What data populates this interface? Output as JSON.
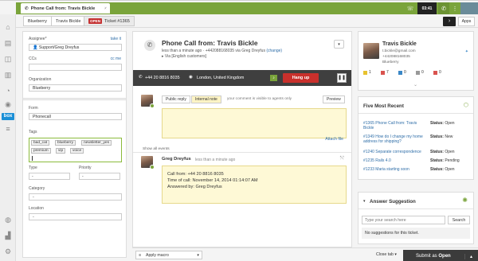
{
  "topbar": {
    "tab_title": "Phone Call from: Travis Bickle",
    "add_label": "+ add",
    "timer": "03:41"
  },
  "crumbs": {
    "org": "Blueberry",
    "user": "Travis Bickle",
    "status_badge": "OPEN",
    "ticket": "Ticket #1365",
    "apps": "Apps"
  },
  "properties": {
    "assignee_label": "Assignee*",
    "take_it": "take it",
    "assignee_value": "Support/Greg Dreyfus",
    "ccs_label": "CCs",
    "cc_me": "cc me",
    "organization_label": "Organization",
    "organization_value": "Blueberry",
    "form_label": "Form",
    "form_value": "Phonecall",
    "tags_label": "Tags",
    "tags": [
      "bad_cat",
      "blueberry",
      "newsletter_yes",
      "premium",
      "vip",
      "voice"
    ],
    "type_label": "Type",
    "type_value": "-",
    "priority_label": "Priority",
    "priority_value": "-",
    "category_label": "Category",
    "category_value": "-",
    "location_label": "Location",
    "location_value": "-"
  },
  "conversation": {
    "subject": "Phone Call from: Travis Bickle",
    "meta_line1": "less than a minute ago · +442088168035 via Greg Dreyfus",
    "change_link": "(change)",
    "meta_line2": "Via [English customers]",
    "call_number": "+44 20 8816 8035",
    "call_location": "London, United Kingdom",
    "hangup_label": "Hang up",
    "public_reply": "Public reply",
    "internal_note": "Internal note",
    "note_hint": "your comment is visible to agents only",
    "preview": "Preview",
    "attach_file": "Attach file",
    "show_all_events": "Show all events",
    "author": "Greg Dreyfus",
    "time_ago": "less than a minute ago",
    "message_lines": [
      "Call from: +44 20 8816 8035",
      "Time of call: November 14, 2014 01:14:07 AM",
      "Answered by: Greg Dreyfus"
    ]
  },
  "bottom": {
    "apply_macro": "Apply macro",
    "close_tab": "Close tab",
    "submit_prefix": "Submit as ",
    "submit_status": "Open"
  },
  "user_card": {
    "name": "Travis Bickle",
    "email": "t.bickle@gmail.com",
    "phone": "+442088168035",
    "org": "Blueberry",
    "stats": [
      "1",
      "7",
      "0",
      "0",
      "0"
    ],
    "stat_colors": [
      "#e8c22e",
      "#d9534f",
      "#3a87c6",
      "#999999",
      "#d9534f"
    ]
  },
  "recent": {
    "title": "Five Most Recent",
    "items": [
      {
        "link": "#1365 Phone Call from: Travis Bickle",
        "status": "Open"
      },
      {
        "link": "#1349 How do I change my home address for shipping?",
        "status": "New"
      },
      {
        "link": "#1240 Separate correspondence",
        "status": "Open"
      },
      {
        "link": "#1235 Rails 4.0",
        "status": "Pending"
      },
      {
        "link": "#1233 Maria starting soon",
        "status": "Open"
      }
    ],
    "status_label": "Status:"
  },
  "answer": {
    "title": "Answer Suggestion",
    "search_placeholder": "Type your search here",
    "search_button": "Search",
    "empty": "No suggestions for this ticket."
  }
}
